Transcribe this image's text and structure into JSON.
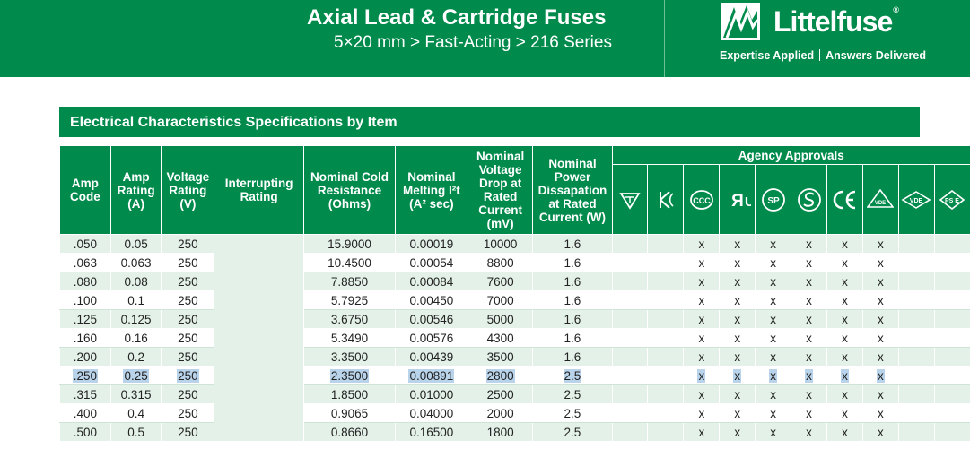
{
  "header": {
    "title": "Axial Lead & Cartridge Fuses",
    "subtitle": "5×20 mm > Fast-Acting > 216  Series",
    "brand": "Littelfuse",
    "brand_mark": "®",
    "tagline_left": "Expertise Applied",
    "tagline_right": "Answers Delivered"
  },
  "section_title": "Electrical Characteristics Specifications by Item",
  "columns": {
    "amp_code": "Amp Code",
    "amp_rating": "Amp Rating (A)",
    "voltage_rating": "Voltage Rating (V)",
    "interrupting": "Interrupting Rating",
    "cold_resistance": "Nominal Cold Resistance (Ohms)",
    "melting": "Nominal Melting I²t (A² sec)",
    "voltage_drop": "Nominal Voltage Drop at Rated Current (mV)",
    "power": "Nominal Power Dissapation at Rated Current (W)",
    "agency": "Agency Approvals"
  },
  "agency_icons": [
    "british-standard-kitemark-icon",
    "ccc-like-icon",
    "ccc-icon",
    "ul-recognized-icon",
    "csa-icon",
    "semko-icon",
    "ce-icon",
    "vde-icon",
    "vde-box-icon",
    "pse-icon"
  ],
  "rows": [
    {
      "code": ".050",
      "amp": "0.05",
      "volt": "250",
      "res": "15.9000",
      "melt": "0.00019",
      "drop": "10000",
      "power": "1.6",
      "agency": [
        "",
        "",
        "x",
        "x",
        "x",
        "x",
        "x",
        "x",
        "",
        ""
      ]
    },
    {
      "code": ".063",
      "amp": "0.063",
      "volt": "250",
      "res": "10.4500",
      "melt": "0.00054",
      "drop": "8800",
      "power": "1.6",
      "agency": [
        "",
        "",
        "x",
        "x",
        "x",
        "x",
        "x",
        "x",
        "",
        ""
      ]
    },
    {
      "code": ".080",
      "amp": "0.08",
      "volt": "250",
      "res": "7.8850",
      "melt": "0.00084",
      "drop": "7600",
      "power": "1.6",
      "agency": [
        "",
        "",
        "x",
        "x",
        "x",
        "x",
        "x",
        "x",
        "",
        ""
      ]
    },
    {
      "code": ".100",
      "amp": "0.1",
      "volt": "250",
      "res": "5.7925",
      "melt": "0.00450",
      "drop": "7000",
      "power": "1.6",
      "agency": [
        "",
        "",
        "x",
        "x",
        "x",
        "x",
        "x",
        "x",
        "",
        ""
      ]
    },
    {
      "code": ".125",
      "amp": "0.125",
      "volt": "250",
      "res": "3.6750",
      "melt": "0.00546",
      "drop": "5000",
      "power": "1.6",
      "agency": [
        "",
        "",
        "x",
        "x",
        "x",
        "x",
        "x",
        "x",
        "",
        ""
      ]
    },
    {
      "code": ".160",
      "amp": "0.16",
      "volt": "250",
      "res": "5.3490",
      "melt": "0.00576",
      "drop": "4300",
      "power": "1.6",
      "agency": [
        "",
        "",
        "x",
        "x",
        "x",
        "x",
        "x",
        "x",
        "",
        ""
      ]
    },
    {
      "code": ".200",
      "amp": "0.2",
      "volt": "250",
      "res": "3.3500",
      "melt": "0.00439",
      "drop": "3500",
      "power": "1.6",
      "agency": [
        "",
        "",
        "x",
        "x",
        "x",
        "x",
        "x",
        "x",
        "",
        ""
      ]
    },
    {
      "code": ".250",
      "amp": "0.25",
      "volt": "250",
      "res": "2.3500",
      "melt": "0.00891",
      "drop": "2800",
      "power": "2.5",
      "agency": [
        "",
        "",
        "x",
        "x",
        "x",
        "x",
        "x",
        "x",
        "",
        ""
      ],
      "selected": true
    },
    {
      "code": ".315",
      "amp": "0.315",
      "volt": "250",
      "res": "1.8500",
      "melt": "0.01000",
      "drop": "2500",
      "power": "2.5",
      "agency": [
        "",
        "",
        "x",
        "x",
        "x",
        "x",
        "x",
        "x",
        "",
        ""
      ]
    },
    {
      "code": ".400",
      "amp": "0.4",
      "volt": "250",
      "res": "0.9065",
      "melt": "0.04000",
      "drop": "2000",
      "power": "2.5",
      "agency": [
        "",
        "",
        "x",
        "x",
        "x",
        "x",
        "x",
        "x",
        "",
        ""
      ]
    },
    {
      "code": ".500",
      "amp": "0.5",
      "volt": "250",
      "res": "0.8660",
      "melt": "0.16500",
      "drop": "1800",
      "power": "2.5",
      "agency": [
        "",
        "",
        "x",
        "x",
        "x",
        "x",
        "x",
        "x",
        "",
        ""
      ]
    }
  ],
  "colors": {
    "brand_green": "#008a4b",
    "row_tint": "#e3f1e8",
    "selection": "#b9d3ea"
  }
}
